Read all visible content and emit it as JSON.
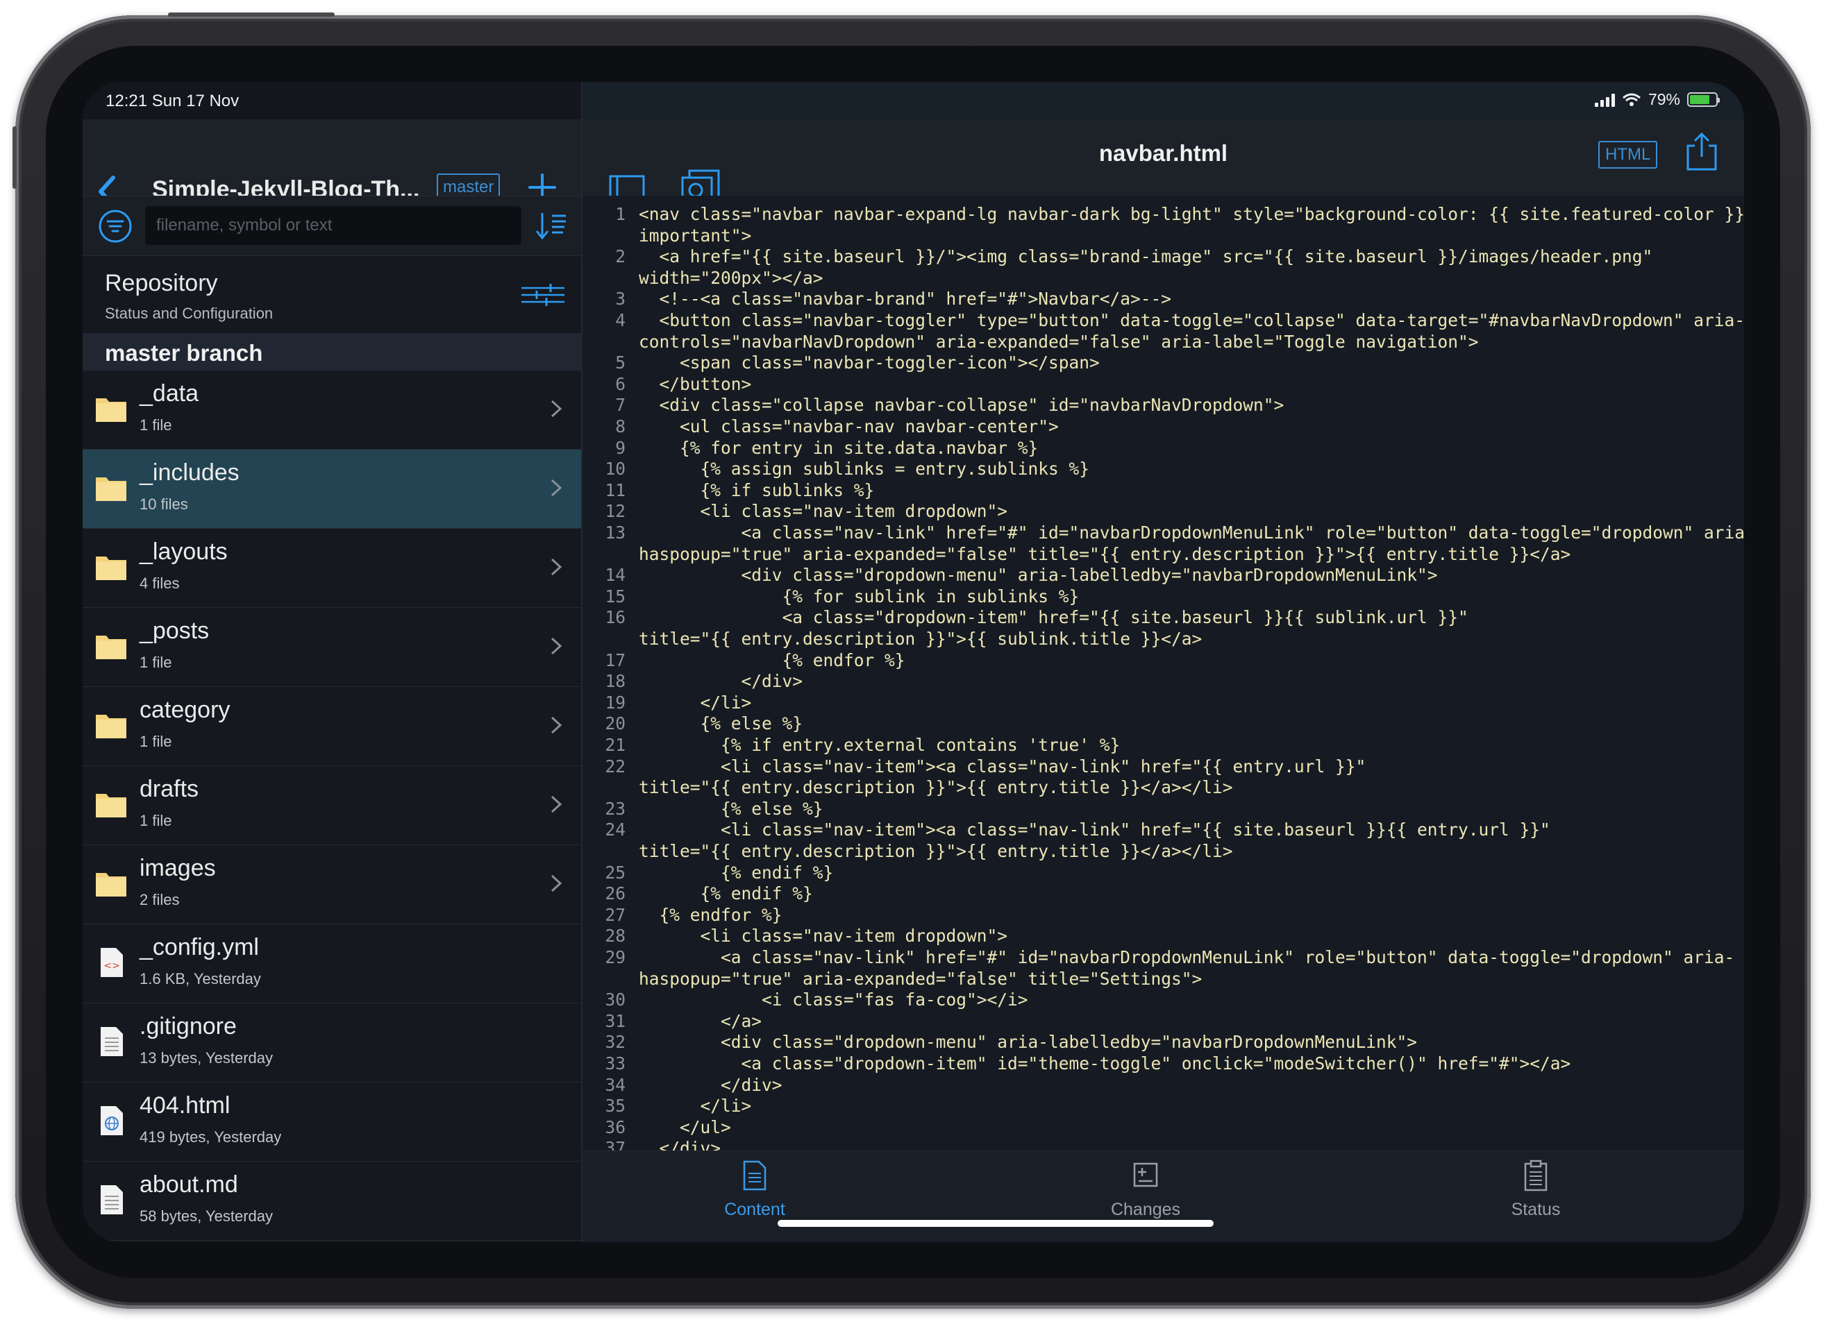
{
  "status_bar": {
    "time": "12:21  Sun 17 Nov",
    "battery": "79%",
    "battery_level": 0.79
  },
  "left_pane": {
    "title": "Simple-Jekyll-Blog-Th...",
    "branch": "master",
    "search_placeholder": "filename, symbol or text",
    "repository": {
      "label": "Repository",
      "sub": "Status and Configuration"
    },
    "branch_header": "master branch",
    "files": [
      {
        "name": "_data",
        "meta": "1 file",
        "type": "folder",
        "selected": false
      },
      {
        "name": "_includes",
        "meta": "10 files",
        "type": "folder",
        "selected": true
      },
      {
        "name": "_layouts",
        "meta": "4 files",
        "type": "folder",
        "selected": false
      },
      {
        "name": "_posts",
        "meta": "1 file",
        "type": "folder",
        "selected": false
      },
      {
        "name": "category",
        "meta": "1 file",
        "type": "folder",
        "selected": false
      },
      {
        "name": "drafts",
        "meta": "1 file",
        "type": "folder",
        "selected": false
      },
      {
        "name": "images",
        "meta": "2 files",
        "type": "folder",
        "selected": false
      },
      {
        "name": "_config.yml",
        "meta": "1.6 KB, Yesterday",
        "type": "code-file",
        "selected": false
      },
      {
        "name": ".gitignore",
        "meta": "13 bytes, Yesterday",
        "type": "text-file",
        "selected": false
      },
      {
        "name": "404.html",
        "meta": "419 bytes, Yesterday",
        "type": "web-file",
        "selected": false
      },
      {
        "name": "about.md",
        "meta": "58 bytes, Yesterday",
        "type": "text-file",
        "selected": false
      }
    ]
  },
  "editor": {
    "filename": "navbar.html",
    "language": "HTML",
    "lines": [
      {
        "n": "1",
        "text": "<nav class=\"navbar navbar-expand-lg navbar-dark bg-light\" style=\"background-color: {{ site.featured-color }}!"
      },
      {
        "n": "",
        "text": "important\">"
      },
      {
        "n": "2",
        "text": "  <a href=\"{{ site.baseurl }}/\"><img class=\"brand-image\" src=\"{{ site.baseurl }}/images/header.png\""
      },
      {
        "n": "",
        "text": "width=\"200px\"></a>"
      },
      {
        "n": "3",
        "text": "  <!--<a class=\"navbar-brand\" href=\"#\">Navbar</a>-->"
      },
      {
        "n": "4",
        "text": "  <button class=\"navbar-toggler\" type=\"button\" data-toggle=\"collapse\" data-target=\"#navbarNavDropdown\" aria-"
      },
      {
        "n": "",
        "text": "controls=\"navbarNavDropdown\" aria-expanded=\"false\" aria-label=\"Toggle navigation\">"
      },
      {
        "n": "5",
        "text": "    <span class=\"navbar-toggler-icon\"></span>"
      },
      {
        "n": "6",
        "text": "  </button>"
      },
      {
        "n": "7",
        "text": "  <div class=\"collapse navbar-collapse\" id=\"navbarNavDropdown\">"
      },
      {
        "n": "8",
        "text": "    <ul class=\"navbar-nav navbar-center\">"
      },
      {
        "n": "9",
        "text": "    {% for entry in site.data.navbar %}"
      },
      {
        "n": "10",
        "text": "      {% assign sublinks = entry.sublinks %}"
      },
      {
        "n": "11",
        "text": "      {% if sublinks %}"
      },
      {
        "n": "12",
        "text": "      <li class=\"nav-item dropdown\">"
      },
      {
        "n": "13",
        "text": "          <a class=\"nav-link\" href=\"#\" id=\"navbarDropdownMenuLink\" role=\"button\" data-toggle=\"dropdown\" aria-"
      },
      {
        "n": "",
        "text": "haspopup=\"true\" aria-expanded=\"false\" title=\"{{ entry.description }}\">{{ entry.title }}</a>"
      },
      {
        "n": "14",
        "text": "          <div class=\"dropdown-menu\" aria-labelledby=\"navbarDropdownMenuLink\">"
      },
      {
        "n": "15",
        "text": "              {% for sublink in sublinks %}"
      },
      {
        "n": "16",
        "text": "              <a class=\"dropdown-item\" href=\"{{ site.baseurl }}{{ sublink.url }}\""
      },
      {
        "n": "",
        "text": "title=\"{{ entry.description }}\">{{ sublink.title }}</a>"
      },
      {
        "n": "17",
        "text": "              {% endfor %}"
      },
      {
        "n": "18",
        "text": "          </div>"
      },
      {
        "n": "19",
        "text": "      </li>"
      },
      {
        "n": "20",
        "text": "      {% else %}"
      },
      {
        "n": "21",
        "text": "        {% if entry.external contains 'true' %}"
      },
      {
        "n": "22",
        "text": "        <li class=\"nav-item\"><a class=\"nav-link\" href=\"{{ entry.url }}\""
      },
      {
        "n": "",
        "text": "title=\"{{ entry.description }}\">{{ entry.title }}</a></li>"
      },
      {
        "n": "23",
        "text": "        {% else %}"
      },
      {
        "n": "24",
        "text": "        <li class=\"nav-item\"><a class=\"nav-link\" href=\"{{ site.baseurl }}{{ entry.url }}\""
      },
      {
        "n": "",
        "text": "title=\"{{ entry.description }}\">{{ entry.title }}</a></li>"
      },
      {
        "n": "25",
        "text": "        {% endif %}"
      },
      {
        "n": "26",
        "text": "      {% endif %}"
      },
      {
        "n": "27",
        "text": "  {% endfor %}"
      },
      {
        "n": "28",
        "text": "      <li class=\"nav-item dropdown\">"
      },
      {
        "n": "29",
        "text": "        <a class=\"nav-link\" href=\"#\" id=\"navbarDropdownMenuLink\" role=\"button\" data-toggle=\"dropdown\" aria-"
      },
      {
        "n": "",
        "text": "haspopup=\"true\" aria-expanded=\"false\" title=\"Settings\">"
      },
      {
        "n": "30",
        "text": "            <i class=\"fas fa-cog\"></i>"
      },
      {
        "n": "31",
        "text": "        </a>"
      },
      {
        "n": "32",
        "text": "        <div class=\"dropdown-menu\" aria-labelledby=\"navbarDropdownMenuLink\">"
      },
      {
        "n": "33",
        "text": "          <a class=\"dropdown-item\" id=\"theme-toggle\" onclick=\"modeSwitcher()\" href=\"#\"></a>"
      },
      {
        "n": "34",
        "text": "        </div>"
      },
      {
        "n": "35",
        "text": "      </li>"
      },
      {
        "n": "36",
        "text": "    </ul>"
      },
      {
        "n": "37",
        "text": "  </div>"
      }
    ]
  },
  "tabs": [
    {
      "label": "Content",
      "icon": "document-icon",
      "active": true
    },
    {
      "label": "Changes",
      "icon": "diff-icon",
      "active": false
    },
    {
      "label": "Status",
      "icon": "clipboard-icon",
      "active": false
    }
  ],
  "colors": {
    "accent": "#3a9be8",
    "folder": "#f3d37a",
    "selected_row": "#234452",
    "code_text": "#ece5b5"
  }
}
